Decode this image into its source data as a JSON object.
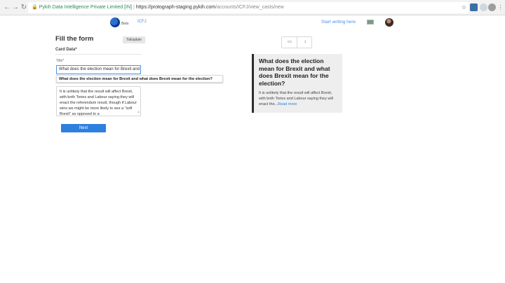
{
  "browser": {
    "secure_label": "Pykih Data Intelligence Private Limited [IN]",
    "url_host": "https://protograph-staging.pykih.com",
    "url_path": "/accounts/ICFJ/view_casts/new"
  },
  "header": {
    "beta_label": "Beta",
    "brand": "ICFJ",
    "start_writing": "Start writing here"
  },
  "form": {
    "title": "Fill the form",
    "toexplain_button": "ToExplain",
    "card_data_label": "Card Data*",
    "title_label": "Title*",
    "title_value": "What does the election mean for Brexit and",
    "autocomplete": "What does the election mean for Brexit and what does Brexit mean for the election?",
    "description": "It is unlikely that the result will affect Brexit, with both Tories and Labour saying they will enact the referendum result, though if Labour wins we might be more likely to see a \"soft Brexit\" as opposed to a",
    "next_button": "Next"
  },
  "preview": {
    "title": "What does the election mean for Brexit and what does Brexit mean for the election?",
    "body": "It is unlikely that the result will affect Brexit, with both Tories and Labour saying they will enact the...",
    "read_more": "Read more"
  }
}
